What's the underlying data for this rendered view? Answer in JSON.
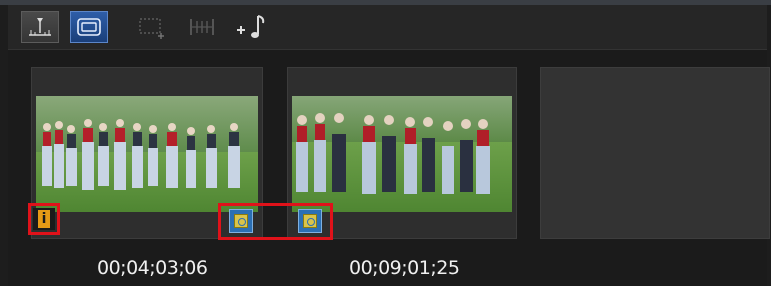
{
  "toolbar": {
    "buttons": [
      {
        "name": "timeline-view-icon",
        "state": "normal"
      },
      {
        "name": "storyboard-view-icon",
        "state": "active"
      },
      {
        "name": "add-clip-frame-icon",
        "state": "disabled"
      },
      {
        "name": "split-markers-icon",
        "state": "disabled"
      },
      {
        "name": "add-music-icon",
        "state": "normal"
      }
    ]
  },
  "clips": [
    {
      "duration": "00;04;03;06",
      "has_info_badge": true,
      "has_transition_out": true
    },
    {
      "duration": "00;09;01;25",
      "has_transition_in": true
    },
    {
      "duration": "",
      "empty": true
    }
  ],
  "colors": {
    "highlight": "#e0121a",
    "active_button": "#2e5ea8",
    "info_badge": "#e59a16",
    "transition_badge": "#2b6fb4"
  }
}
